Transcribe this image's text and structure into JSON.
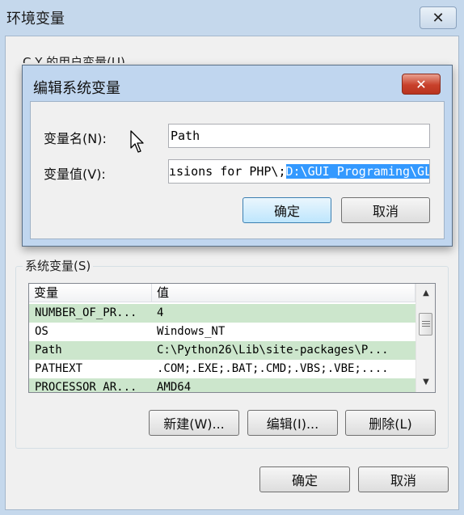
{
  "outer": {
    "title": "环境变量",
    "close_glyph": "✕",
    "user_group_label": "C  Y 的用户变量(U)",
    "system_group_label": "系统变量(S)",
    "system_table": {
      "headers": [
        "变量",
        "值"
      ],
      "rows": [
        {
          "name": "NUMBER_OF_PR...",
          "value": "4"
        },
        {
          "name": "OS",
          "value": "Windows_NT"
        },
        {
          "name": "Path",
          "value": "C:\\Python26\\Lib\\site-packages\\P..."
        },
        {
          "name": "PATHEXT",
          "value": ".COM;.EXE;.BAT;.CMD;.VBS;.VBE;...."
        },
        {
          "name": "PROCESSOR_AR...",
          "value": "AMD64"
        }
      ]
    },
    "buttons": {
      "new": "新建(W)...",
      "edit": "编辑(I)...",
      "delete": "删除(L)",
      "ok": "确定",
      "cancel": "取消"
    }
  },
  "dialog": {
    "title": "编辑系统变量",
    "close_glyph": "✕",
    "name_label": "变量名(N):",
    "value_label": "变量值(V):",
    "name_value": "Path",
    "value_unselected": "ısions for PHP\\;",
    "value_selected": "D:\\GUI_Programing\\GL",
    "ok": "确定",
    "cancel": "取消"
  },
  "colors": {
    "selection": "#3399ff",
    "row_highlight": "#cce6cc",
    "close_red": "#c8402a"
  }
}
